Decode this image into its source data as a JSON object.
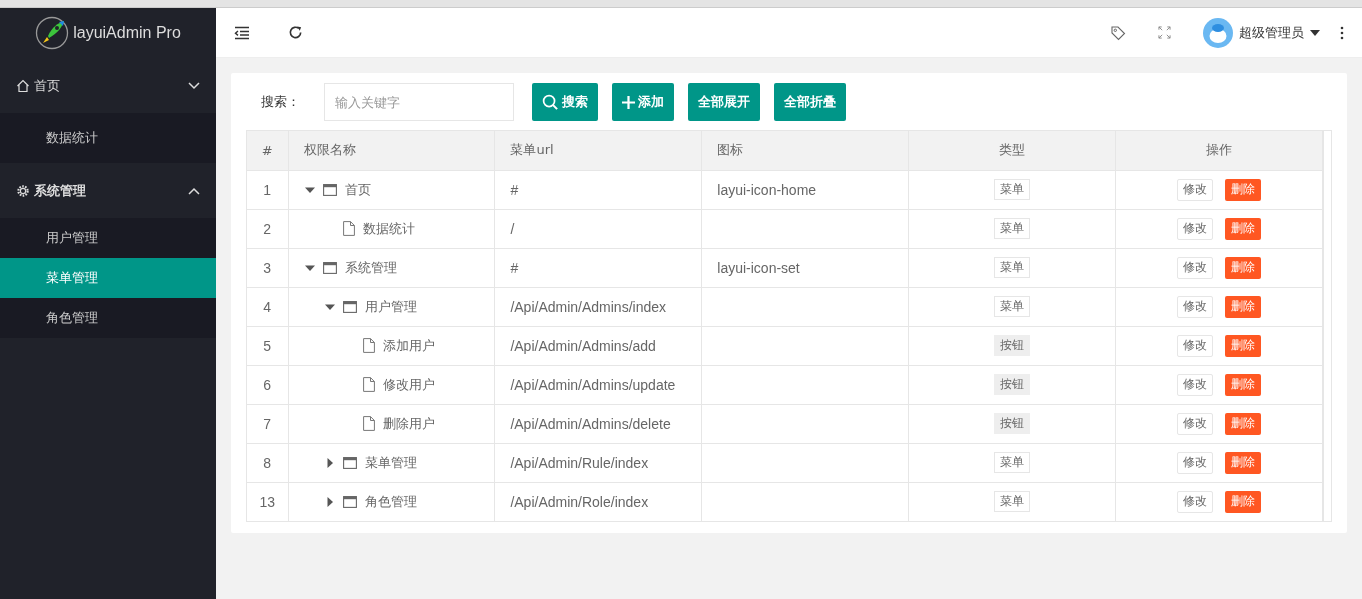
{
  "sidebar": {
    "logo_text": "layuiAdmin Pro",
    "groups": [
      {
        "label": "首页",
        "expanded": false,
        "items": [
          {
            "label": "数据统计",
            "selected": false
          }
        ]
      },
      {
        "label": "系统管理",
        "expanded": true,
        "items": [
          {
            "label": "用户管理",
            "selected": false
          },
          {
            "label": "菜单管理",
            "selected": true
          },
          {
            "label": "角色管理",
            "selected": false
          }
        ]
      }
    ]
  },
  "header": {
    "user_name": "超级管理员"
  },
  "toolbar": {
    "search_label": "搜索：",
    "search_placeholder": "输入关键字",
    "buttons": [
      "搜索",
      "添加",
      "全部展开",
      "全部折叠"
    ]
  },
  "table": {
    "columns": [
      "#",
      "权限名称",
      "菜单url",
      "图标",
      "类型",
      "操作"
    ],
    "rows": [
      {
        "id": "1",
        "name": "首页",
        "kind": "branch",
        "expanded": true,
        "url": "#",
        "icon": "layui-icon-home",
        "type": {
          "label": "菜单",
          "kind": "menu"
        },
        "edit": "修改",
        "delete": "删除",
        "children": [
          {
            "id": "2",
            "name": "数据统计",
            "kind": "leaf",
            "url": "/",
            "type": {
              "label": "菜单",
              "kind": "menu"
            },
            "edit": "修改",
            "delete": "删除"
          }
        ]
      },
      {
        "id": "3",
        "name": "系统管理",
        "kind": "branch",
        "expanded": true,
        "url": "#",
        "icon": "layui-icon-set",
        "type": {
          "label": "菜单",
          "kind": "menu"
        },
        "edit": "修改",
        "delete": "删除",
        "children": [
          {
            "id": "4",
            "name": "用户管理",
            "kind": "branch",
            "expanded": true,
            "url": "/Api/Admin/Admins/index",
            "type": {
              "label": "菜单",
              "kind": "menu"
            },
            "edit": "修改",
            "delete": "删除",
            "children": [
              {
                "id": "5",
                "name": "添加用户",
                "kind": "leaf",
                "url": "/Api/Admin/Admins/add",
                "type": {
                  "label": "按钮",
                  "kind": "button"
                },
                "edit": "修改",
                "delete": "删除"
              },
              {
                "id": "6",
                "name": "修改用户",
                "kind": "leaf",
                "url": "/Api/Admin/Admins/update",
                "type": {
                  "label": "按钮",
                  "kind": "button"
                },
                "edit": "修改",
                "delete": "删除"
              },
              {
                "id": "7",
                "name": "删除用户",
                "kind": "leaf",
                "url": "/Api/Admin/Admins/delete",
                "type": {
                  "label": "按钮",
                  "kind": "button"
                },
                "edit": "修改",
                "delete": "删除"
              }
            ]
          },
          {
            "id": "8",
            "name": "菜单管理",
            "kind": "branch",
            "expanded": false,
            "url": "/Api/Admin/Rule/index",
            "type": {
              "label": "菜单",
              "kind": "menu"
            },
            "edit": "修改",
            "delete": "删除"
          },
          {
            "id": "13",
            "name": "角色管理",
            "kind": "branch",
            "expanded": false,
            "url": "/Api/Admin/Role/index",
            "type": {
              "label": "菜单",
              "kind": "menu"
            },
            "edit": "修改",
            "delete": "删除"
          }
        ]
      }
    ]
  }
}
